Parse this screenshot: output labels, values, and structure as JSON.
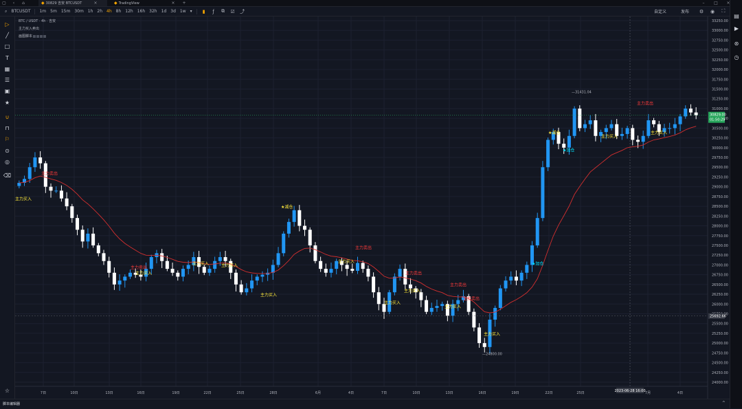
{
  "tabs": [
    {
      "label": "30829 吉安 BTCUSDT",
      "active": true
    },
    {
      "label": "TradingView",
      "active": false
    }
  ],
  "toolbar": {
    "symbol": "BTCUSDT",
    "intervals": [
      "1m",
      "5m",
      "15m",
      "30m",
      "1h",
      "2h",
      "4h",
      "8h",
      "12h",
      "16h",
      "32h",
      "1d",
      "3d",
      "1w"
    ],
    "selected_interval": "4h",
    "right_a": "自定义",
    "right_b": "发布"
  },
  "legend": {
    "pair": "BTC / USDT · 4h · 吉安",
    "indicator": "主力买入卖出",
    "script": "画图脚本"
  },
  "price_axis": {
    "labels": [
      "33250.00",
      "33000.00",
      "32750.00",
      "32500.00",
      "32250.00",
      "32000.00",
      "31750.00",
      "31500.00",
      "31250.00",
      "31000.00",
      "30750.00",
      "30500.00",
      "30250.00",
      "30000.00",
      "29750.00",
      "29500.00",
      "29250.00",
      "29000.00",
      "28750.00",
      "28500.00",
      "28250.00",
      "28000.00",
      "27750.00",
      "27500.00",
      "27250.00",
      "27000.00",
      "26750.00",
      "26500.00",
      "26250.00",
      "26000.00",
      "25750.00",
      "25500.00",
      "25250.00",
      "25000.00",
      "24750.00",
      "24500.00",
      "24250.00",
      "24000.00"
    ],
    "current_price": "30829.00",
    "current_countdown": "01:50:29",
    "crosshair_price": "25692.66"
  },
  "time_axis": {
    "labels": [
      "7日",
      "10日",
      "13日",
      "16日",
      "19日",
      "22日",
      "25日",
      "28日",
      "6月",
      "4日",
      "7日",
      "10日",
      "13日",
      "16日",
      "19日",
      "22日",
      "25日",
      "7月",
      "4日"
    ],
    "crosshair_time": "2023-06-28 16:00"
  },
  "annotations": {
    "high_label": "31431.04",
    "low_label": "24800.00",
    "buy": "主力买入",
    "sell": "主力卖出",
    "reduce": "★减仓",
    "add": "★加仓"
  },
  "colors": {
    "background": "#131722",
    "bull": "#2196f3",
    "bear": "#ffffff",
    "buy_text": "#ffeb3b",
    "sell_text": "#ff3b3b",
    "add_text": "#00e5ff",
    "price_tag": "#26a65b",
    "ma_red": "#d32f2f",
    "ma_green": "#1b8a3a"
  },
  "bottom": {
    "label": "脚本编辑器"
  },
  "chart_data": {
    "type": "candlestick",
    "symbol": "BTCUSDT",
    "interval": "4h",
    "ylim": [
      24000,
      33250
    ],
    "x_ticks": [
      "7日",
      "10日",
      "13日",
      "16日",
      "19日",
      "22日",
      "25日",
      "28日",
      "6月",
      "4日",
      "7日",
      "10日",
      "13日",
      "16日",
      "19日",
      "22日",
      "25日",
      "7月",
      "4日"
    ],
    "closes": [
      29100,
      29200,
      29500,
      29750,
      29600,
      29000,
      28900,
      28900,
      28700,
      28500,
      28200,
      27900,
      27600,
      27800,
      27500,
      27300,
      27100,
      26800,
      26500,
      26600,
      26700,
      26800,
      26750,
      26700,
      26900,
      27200,
      27300,
      27100,
      26900,
      26800,
      26700,
      26900,
      27000,
      27200,
      26950,
      26800,
      26900,
      27100,
      27200,
      27100,
      26800,
      26500,
      26300,
      26400,
      26600,
      26700,
      26750,
      26800,
      27000,
      27300,
      27800,
      28100,
      28400,
      28000,
      27900,
      27500,
      27100,
      26900,
      26800,
      26900,
      27100,
      27000,
      26900,
      26850,
      27050,
      26900,
      26700,
      26300,
      26000,
      25800,
      26300,
      26700,
      26900,
      26500,
      26400,
      26300,
      26100,
      25800,
      25900,
      25950,
      26000,
      25700,
      26000,
      26100,
      26200,
      25800,
      25400,
      25000,
      24900,
      25600,
      25900,
      26400,
      26600,
      26700,
      26600,
      26800,
      27000,
      27500,
      28200,
      29500,
      30200,
      30400,
      30100,
      30000,
      30300,
      31000,
      30500,
      30600,
      30700,
      30300,
      30400,
      30500,
      30600,
      30300,
      30350,
      30500,
      30200,
      30150,
      30300,
      30700,
      30600,
      30400,
      30500,
      30500,
      30600,
      30800,
      31000,
      30900,
      30829
    ],
    "signals": [
      {
        "label": "主力买入",
        "type": "buy"
      },
      {
        "label": "主力卖出",
        "type": "sell"
      },
      {
        "label": "★减仓",
        "type": "reduce"
      },
      {
        "label": "★加仓",
        "type": "add"
      }
    ]
  }
}
